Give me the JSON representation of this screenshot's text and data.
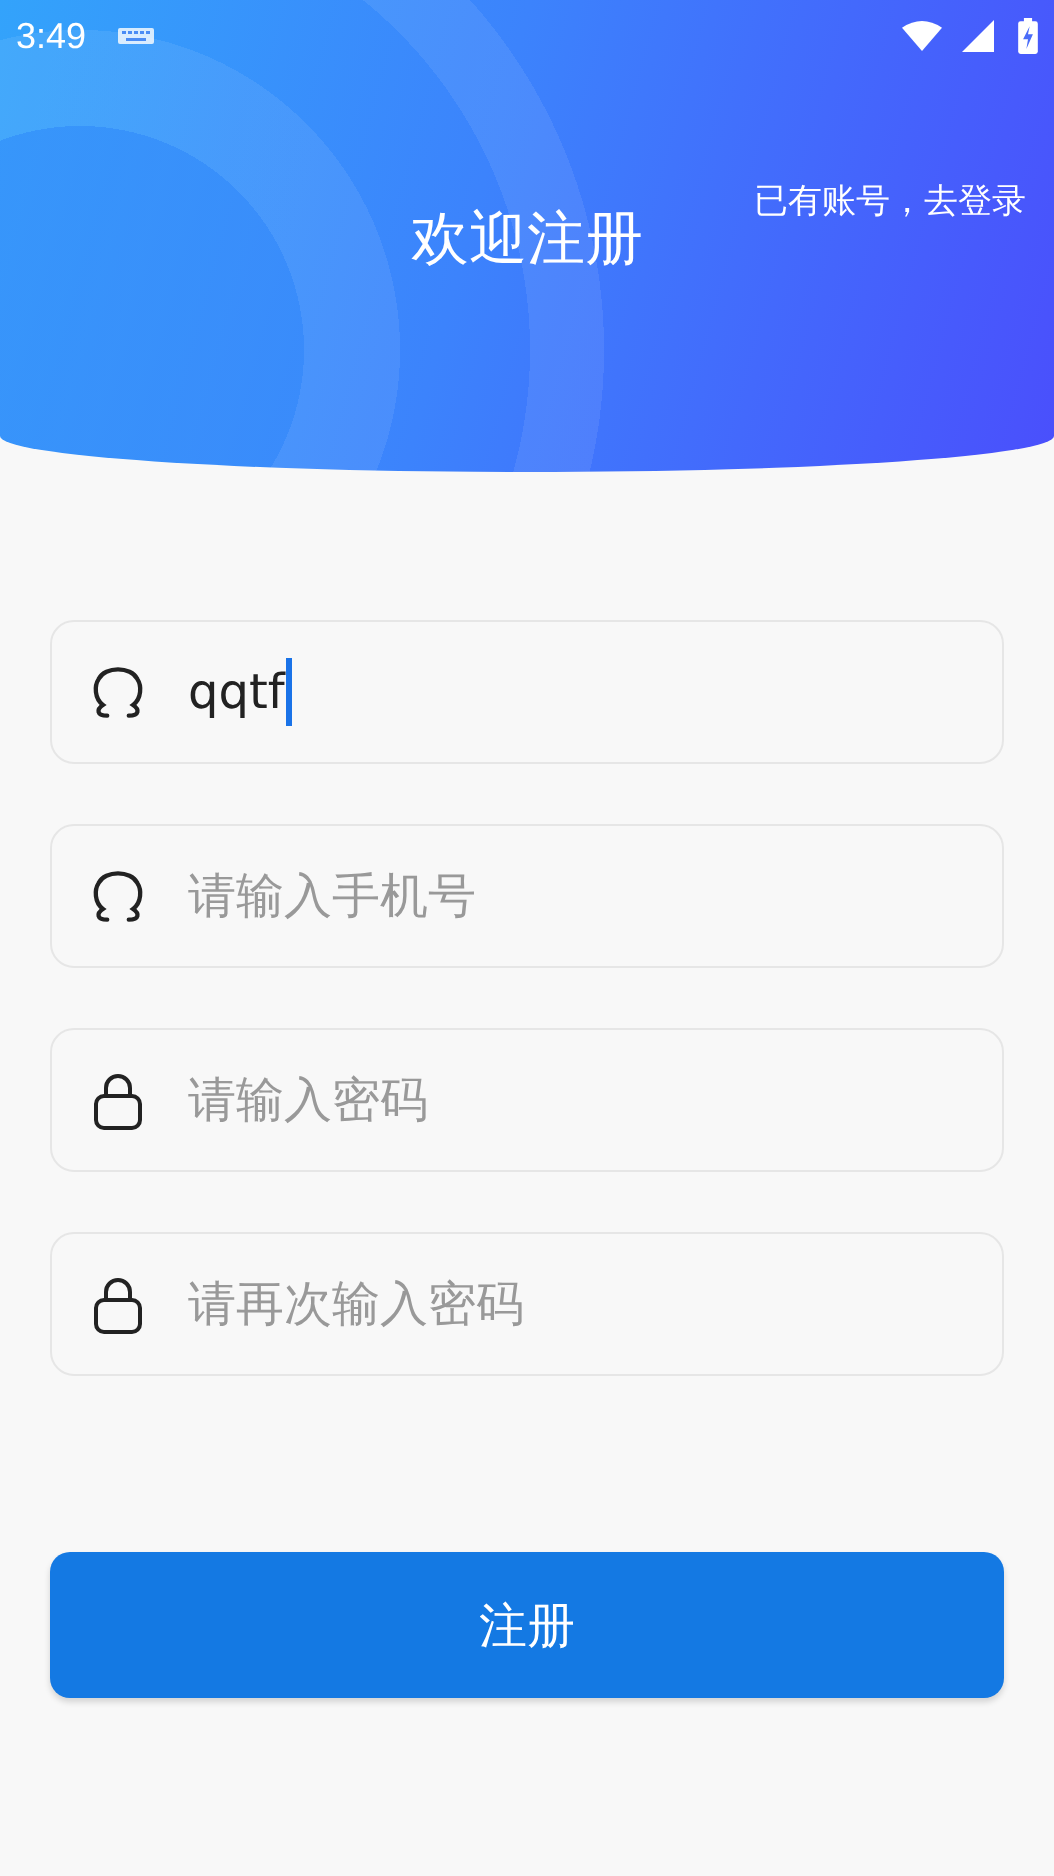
{
  "status_bar": {
    "time": "3:49"
  },
  "header": {
    "title": "欢迎注册",
    "login_link": "已有账号，去登录"
  },
  "fields": [
    {
      "kind": "user",
      "value": "qqtf",
      "focused": true
    },
    {
      "kind": "user",
      "placeholder": "请输入手机号",
      "focused": false
    },
    {
      "kind": "lock",
      "placeholder": "请输入密码",
      "focused": false
    },
    {
      "kind": "lock",
      "placeholder": "请再次输入密码",
      "focused": false
    }
  ],
  "submit_button": "注册"
}
